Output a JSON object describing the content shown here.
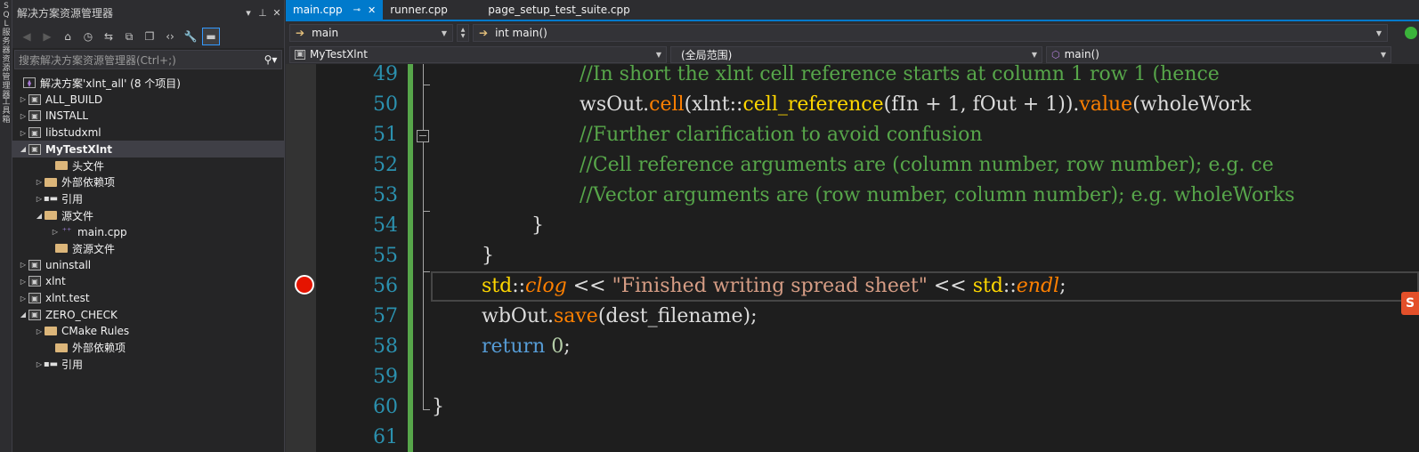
{
  "vertical_strip": {
    "text1": "SQL服务器资源管理器",
    "text2": "工具箱"
  },
  "solution_explorer": {
    "title": "解决方案资源管理器",
    "search_placeholder": "搜索解决方案资源管理器(Ctrl+;)",
    "solution_label": "解决方案'xlnt_all' (8 个项目)",
    "items": [
      {
        "label": "ALL_BUILD",
        "kind": "project",
        "arrow": "▷"
      },
      {
        "label": "INSTALL",
        "kind": "project",
        "arrow": "▷"
      },
      {
        "label": "libstudxml",
        "kind": "project",
        "arrow": "▷"
      },
      {
        "label": "MyTestXlnt",
        "kind": "project",
        "arrow": "◢"
      },
      {
        "label": "头文件",
        "kind": "folder",
        "arrow": ""
      },
      {
        "label": "外部依赖项",
        "kind": "folder",
        "arrow": "▷"
      },
      {
        "label": "引用",
        "kind": "ref",
        "arrow": "▷"
      },
      {
        "label": "源文件",
        "kind": "folder",
        "arrow": "◢"
      },
      {
        "label": "main.cpp",
        "kind": "cpp",
        "arrow": "▷"
      },
      {
        "label": "资源文件",
        "kind": "folder",
        "arrow": ""
      },
      {
        "label": "uninstall",
        "kind": "project",
        "arrow": "▷"
      },
      {
        "label": "xlnt",
        "kind": "project",
        "arrow": "▷"
      },
      {
        "label": "xlnt.test",
        "kind": "project",
        "arrow": "▷"
      },
      {
        "label": "ZERO_CHECK",
        "kind": "project",
        "arrow": "◢"
      },
      {
        "label": "CMake Rules",
        "kind": "folder",
        "arrow": "▷"
      },
      {
        "label": "外部依赖项",
        "kind": "folder",
        "arrow": ""
      },
      {
        "label": "引用",
        "kind": "ref",
        "arrow": "▷"
      }
    ]
  },
  "editor": {
    "tabs": [
      {
        "label": "main.cpp",
        "pin": "⊸",
        "close": "✕"
      },
      {
        "label": "runner.cpp"
      },
      {
        "label": "page_setup_test_suite.cpp"
      }
    ],
    "nav": {
      "config": "main",
      "function": "int main()",
      "project": "MyTestXlnt",
      "scope": "(全局范围)",
      "member": "main()"
    },
    "line_numbers": [
      "49",
      "50",
      "51",
      "52",
      "53",
      "54",
      "55",
      "56",
      "57",
      "58",
      "59",
      "60",
      "61"
    ],
    "code": {
      "l49": "//In short the xlnt cell reference starts at column 1 row 1 (hence",
      "l50_a": "wsOut.",
      "l50_b": "cell",
      "l50_c": "(xlnt::",
      "l50_d": "cell_reference",
      "l50_e": "(fIn + 1, fOut + 1)).",
      "l50_f": "value",
      "l50_g": "(wholeWork",
      "l51": "//Further clarification to avoid confusion",
      "l52": "//Cell reference arguments are (column number, row number); e.g. ce",
      "l53": "//Vector arguments are (row number, column number); e.g. wholeWorks",
      "l54": "}",
      "l55": "}",
      "l56_a": "std",
      "l56_b": "::",
      "l56_c": "clog",
      "l56_d": " << ",
      "l56_e": "\"Finished writing spread sheet\"",
      "l56_f": " << ",
      "l56_g": "std",
      "l56_h": "::",
      "l56_i": "endl",
      "l56_j": ";",
      "l57_a": "wbOut.",
      "l57_b": "save",
      "l57_c": "(dest_filename);",
      "l58_a": "return",
      "l58_b": " ",
      "l58_c": "0",
      "l58_d": ";",
      "l60": "}"
    },
    "breakpoint_line": "56"
  },
  "ime_badge": "S"
}
